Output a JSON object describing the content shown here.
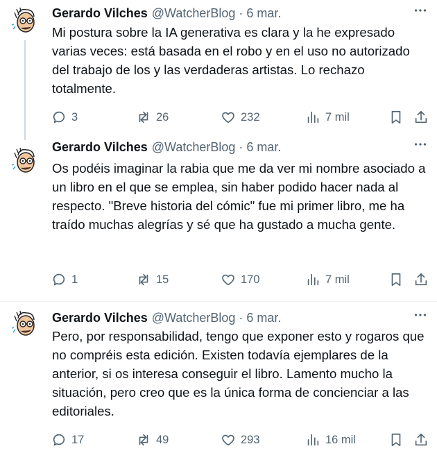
{
  "author": {
    "name": "Gerardo Vilches",
    "handle": "@WatcherBlog"
  },
  "tweets": [
    {
      "date": "6 mar.",
      "text": "Mi postura sobre la IA generativa es clara y la he expresado varias veces: está basada en el robo y en el uso no autorizado del trabajo de los y las verdaderas artistas. Lo rechazo totalmente.",
      "replies": "3",
      "retweets": "26",
      "likes": "232",
      "views": "7 mil"
    },
    {
      "date": "6 mar.",
      "text": "Os podéis imaginar la rabia que me da ver mi nombre asociado a un libro en el que se emplea, sin haber podido hacer nada al respecto. \"Breve historia del cómic\" fue mi primer libro, me ha traído muchas alegrías y sé que ha gustado a mucha gente.",
      "replies": "1",
      "retweets": "15",
      "likes": "170",
      "views": "7 mil"
    },
    {
      "date": "6 mar.",
      "text": "Pero, por responsabilidad, tengo que exponer esto y rogaros que no compréis esta edición. Existen todavía ejemplares de la anterior, si os interesa conseguir el libro. Lamento mucho la situación, pero creo que es la única forma de concienciar a las editoriales.",
      "replies": "17",
      "retweets": "49",
      "likes": "293",
      "views": "16 mil"
    }
  ],
  "icons": {
    "avatar": "cartoon-avatar-icon",
    "more": "more-dots-icon",
    "reply": "reply-icon",
    "retweet": "retweet-icon",
    "like": "heart-icon",
    "views": "views-chart-icon",
    "bookmark": "bookmark-icon",
    "share": "share-icon"
  },
  "colors": {
    "text": "#0f1419",
    "secondary": "#536471",
    "thread_line": "#cfd9de",
    "divider": "#eff3f4"
  }
}
